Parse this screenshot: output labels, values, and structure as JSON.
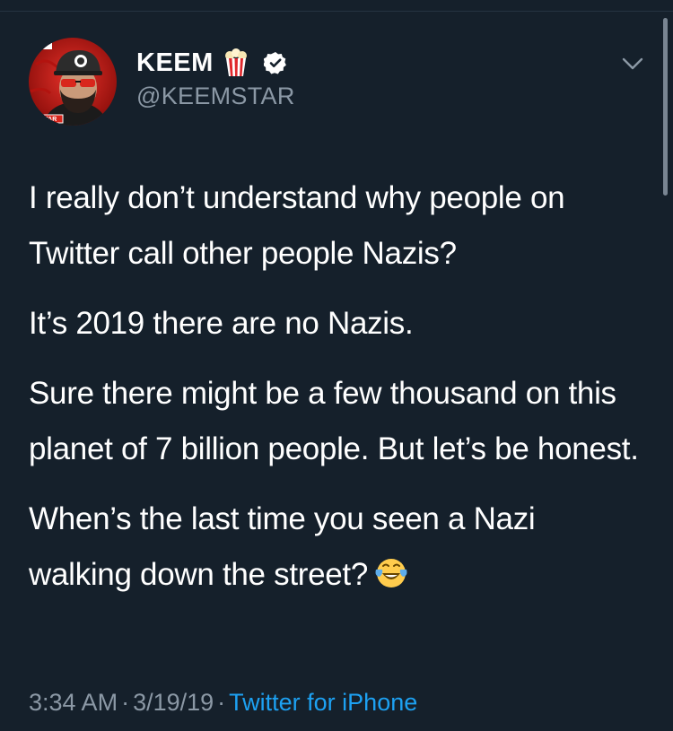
{
  "colors": {
    "background": "#15202b",
    "text_primary": "#ffffff",
    "text_secondary": "#8b98a5",
    "link": "#1da1f2",
    "verified_badge": "#ffffff"
  },
  "author": {
    "display_name": "KEEM",
    "handle": "@KEEMSTAR",
    "name_emoji_icon": "popcorn-icon",
    "verified_icon": "verified-badge-icon",
    "avatar_text": "STAR"
  },
  "header": {
    "menu_icon": "chevron-down-icon"
  },
  "tweet": {
    "paragraphs": [
      "I really don’t understand why people on Twitter call other people Nazis?",
      "It’s 2019 there are no Nazis.",
      "Sure there might be a few thousand on this planet of 7 billion people. But let’s be honest.",
      "When’s the last time you seen a Nazi walking down the street?"
    ],
    "trailing_emoji_icon": "face-with-tears-of-joy-icon"
  },
  "meta": {
    "time": "3:34 AM",
    "date": "3/19/19",
    "separator": "·",
    "source": "Twitter for iPhone"
  }
}
